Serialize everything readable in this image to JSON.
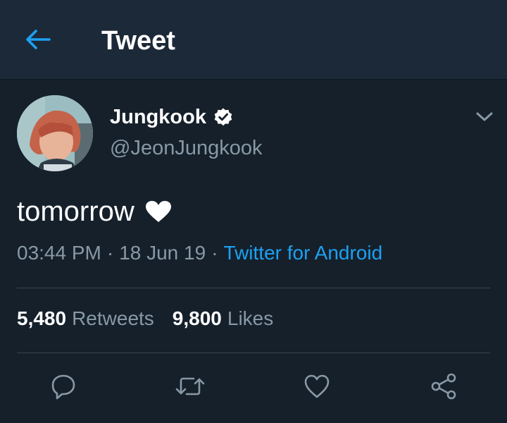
{
  "header": {
    "title": "Tweet",
    "back_icon": "arrow-left-icon"
  },
  "tweet": {
    "author": {
      "display_name": "Jungkook",
      "handle": "@JeonJungkook",
      "verified": true
    },
    "text": "tomorrow",
    "emoji": "heart-emoji",
    "meta": {
      "time": "03:44 PM",
      "separator": "·",
      "date": "18 Jun 19",
      "source": "Twitter for Android"
    },
    "stats": {
      "retweets_count": "5,480",
      "retweets_label": "Retweets",
      "likes_count": "9,800",
      "likes_label": "Likes"
    },
    "actions": [
      "reply-icon",
      "retweet-icon",
      "like-icon",
      "share-icon"
    ]
  },
  "colors": {
    "background": "#15202b",
    "header_background": "#1c2938",
    "accent": "#1da1f2",
    "secondary_text": "#8899a6",
    "divider": "#38444d"
  }
}
